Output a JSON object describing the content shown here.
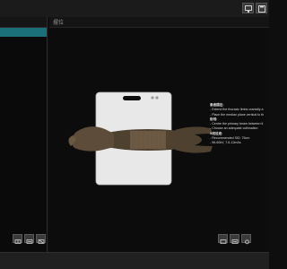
{
  "toolbar": {
    "buttons": [
      {
        "name": "monitor-button",
        "icon": "monitor-icon"
      },
      {
        "name": "save-button",
        "icon": "save-icon"
      }
    ]
  },
  "right_panel": {
    "title": "摆位"
  },
  "instructions": {
    "positioning_heading": "患者摆位:",
    "positioning_items": [
      "- Extend the thoracic limbs cranially a",
      "- Place the median plane vertical to th"
    ],
    "beam_heading": "射线:",
    "beam_items": [
      "- Centre the primary beam between tl",
      "- Choose an adequate collimation"
    ],
    "exposure_heading": "X线设定:",
    "exposure_items": [
      "- Recommended SID: 75cm",
      "- 56-60kV, 7.6-12mAs"
    ]
  },
  "colors": {
    "selection": "#1b6f7a",
    "background": "#0e0e0e",
    "cassette": "#e8e8e8",
    "animal": "#5a4a38"
  }
}
